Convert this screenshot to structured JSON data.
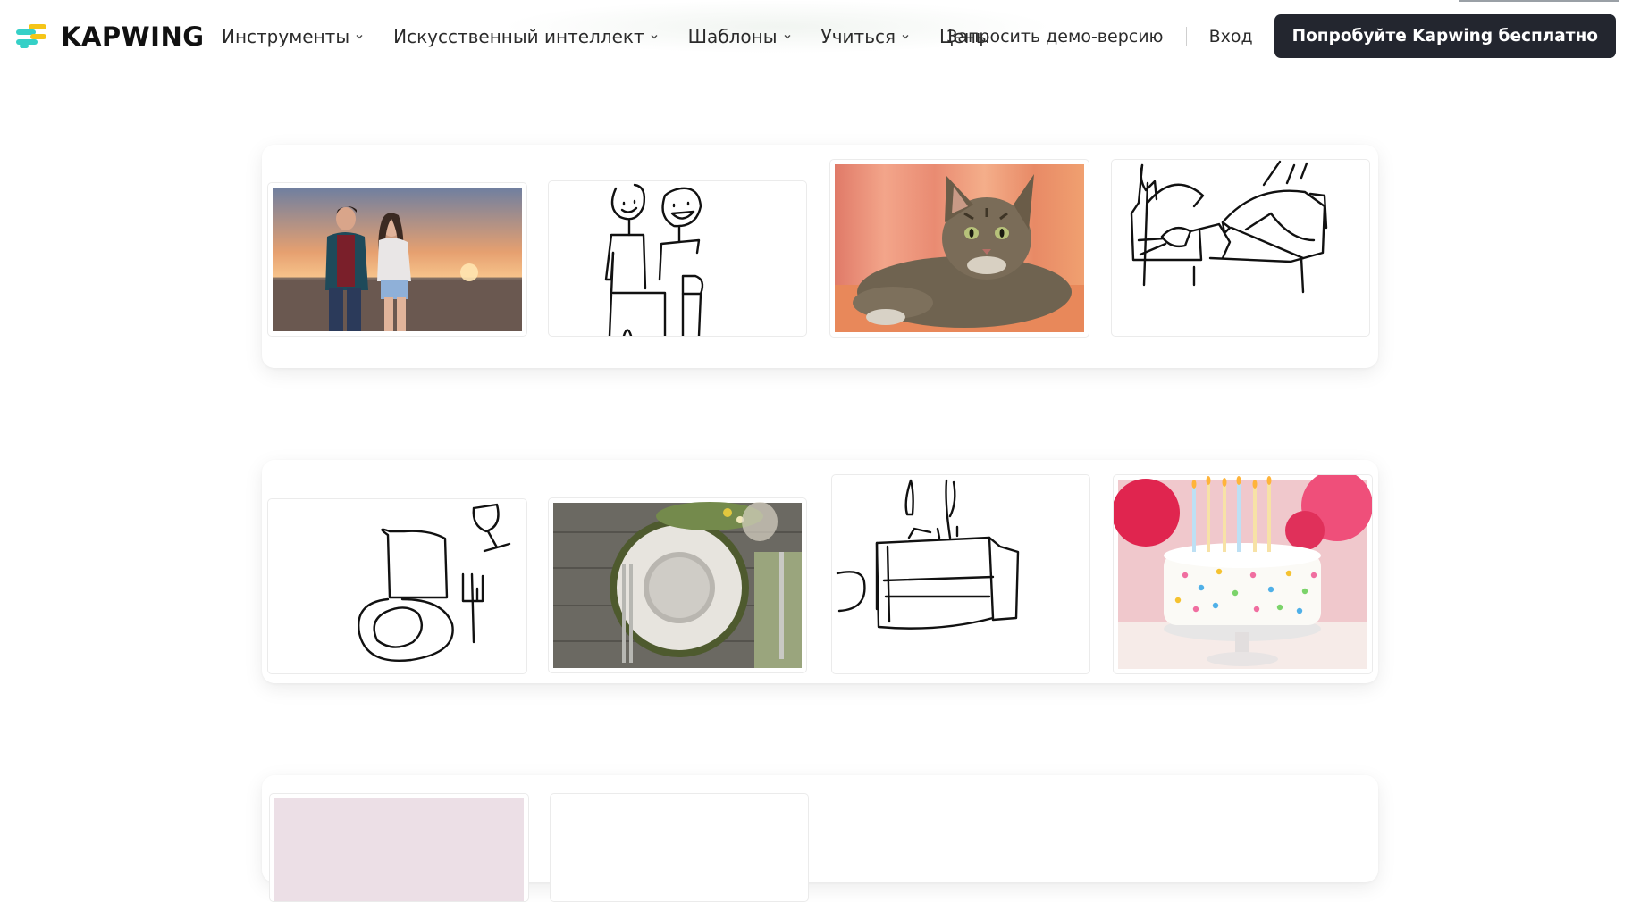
{
  "header": {
    "logo_text": "KAPWING",
    "nav": [
      {
        "label": "Инструменты",
        "has_dropdown": true
      },
      {
        "label": "Искусственный интеллект",
        "has_dropdown": true
      },
      {
        "label": "Шаблоны",
        "has_dropdown": true
      },
      {
        "label": "Учиться",
        "has_dropdown": true
      },
      {
        "label": "Цены",
        "has_dropdown": false
      }
    ],
    "demo_label": "Запросить демо-версию",
    "login_label": "Вход",
    "cta_label": "Попробуйте Kapwing бесплатно"
  },
  "colors": {
    "cta_background": "#23262f",
    "logo_yellow": "#f5c518",
    "logo_teal": "#35d0c7"
  },
  "gallery": {
    "rows": [
      {
        "tiles": [
          "couple-on-beach-photo",
          "couple-sketch-drawing",
          "tabby-cat-photo",
          "cat-sketch-drawing"
        ]
      },
      {
        "tiles": [
          "table-setting-sketch-drawing",
          "table-setting-photo",
          "birthday-cake-sketch-drawing",
          "birthday-cake-photo"
        ]
      },
      {
        "tiles": [
          "partial-photo",
          "partial-drawing"
        ]
      }
    ]
  }
}
